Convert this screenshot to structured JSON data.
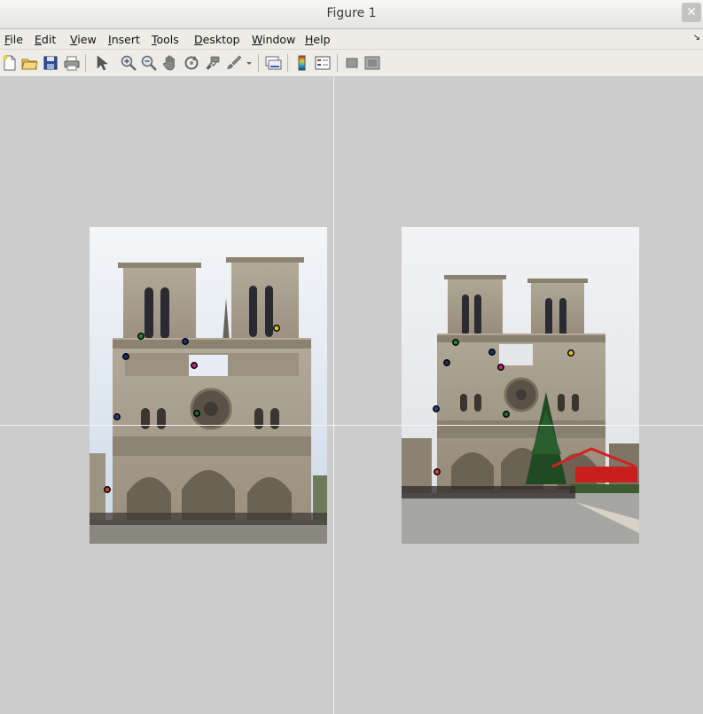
{
  "window": {
    "title": "Figure 1",
    "close_glyph": "✕"
  },
  "menu": [
    {
      "label": "File",
      "key": "F",
      "rest": "ile"
    },
    {
      "label": "Edit",
      "key": "E",
      "rest": "dit"
    },
    {
      "label": "View",
      "key": "V",
      "rest": "iew"
    },
    {
      "label": "Insert",
      "key": "I",
      "rest": "nsert"
    },
    {
      "label": "Tools",
      "key": "T",
      "rest": "ools"
    },
    {
      "label": "Desktop",
      "key": "D",
      "rest": "esktop"
    },
    {
      "label": "Window",
      "key": "W",
      "rest": "indow"
    },
    {
      "label": "Help",
      "key": "H",
      "rest": "elp"
    }
  ],
  "menu_dock_glyph": "↘",
  "toolbar": [
    "new-figure-icon",
    "open-file-icon",
    "save-figure-icon",
    "print-figure-icon",
    "edit-plot-arrow-icon",
    "zoom-in-icon",
    "zoom-out-icon",
    "pan-hand-icon",
    "rotate-3d-icon",
    "data-cursor-icon",
    "brush-icon",
    "brush-dropdown-icon",
    "link-plot-icon",
    "insert-colorbar-icon",
    "insert-legend-icon",
    "hide-plot-tools-icon",
    "show-plot-tools-icon"
  ],
  "images": [
    {
      "name": "left-image",
      "description_hidden": true
    },
    {
      "name": "right-image",
      "description_hidden": true
    }
  ],
  "keypoint_colors": [
    "#1f8a2a",
    "#1a2f7a",
    "#16306b",
    "#c0257a",
    "#d9c51e",
    "#1a6a2f",
    "#2b3f7f",
    "#c8432f"
  ]
}
